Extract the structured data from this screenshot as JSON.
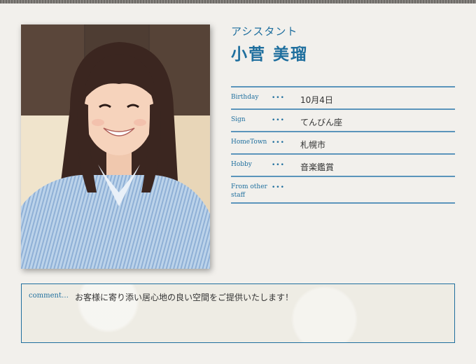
{
  "staff": {
    "role": "アシスタント",
    "name": "小菅 美瑠"
  },
  "profile": {
    "rows": [
      {
        "label": "Birthday",
        "value": "10月4日"
      },
      {
        "label": "Sign",
        "value": "てんびん座"
      },
      {
        "label": "HomeTown",
        "value": "札幌市"
      },
      {
        "label": "Hobby",
        "value": "音楽鑑賞"
      },
      {
        "label": "From other staff",
        "value": ""
      }
    ],
    "separator": "•••"
  },
  "comment": {
    "label": "comment…",
    "text": "お客様に寄り添い居心地の良い空間をご提供いたします！"
  },
  "colors": {
    "accent": "#1f6f9e",
    "rule": "#5b95bb",
    "background": "#f2f0ec"
  }
}
